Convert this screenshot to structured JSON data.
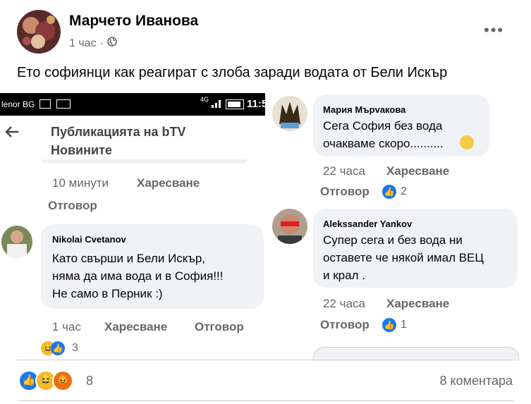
{
  "post": {
    "author": "Марчето Иванова",
    "time": "1 час",
    "text": "Ето софиянци как реагират с злоба заради водата от Бели Искър",
    "reactions_count": "8",
    "comments_count": "8 коментара"
  },
  "left_shot": {
    "statusbar": {
      "carrier": "lenor BG",
      "signal": "4G",
      "time": "11:5"
    },
    "header_title": "Публикацията на bTV Новините",
    "prev_time": "10 минути",
    "prev_like": "Харесване",
    "prev_reply": "Отговор",
    "comment": {
      "name": "Nikolai Cvetanov",
      "text_lines": [
        "Като свърши и Бели Искър,",
        "няма да има вода и в София!!!",
        "Не само в Перник :)"
      ],
      "time": "1 час",
      "like": "Харесване",
      "reply": "Отговор",
      "reactions": "3"
    }
  },
  "right_shot": {
    "comment1": {
      "name": "Мария Мърvакова",
      "text_lines": [
        "Сега София без вода",
        "очакваме скоро.........."
      ],
      "time": "22 часа",
      "like": "Харесване",
      "reply": "Отговор",
      "reactions": "2"
    },
    "comment2": {
      "name": "Alekssander Yankov",
      "text_lines": [
        "Супер сега и без вода ни",
        "оставете  че някой имал ВЕЦ",
        "и крал ."
      ],
      "time": "22 часа",
      "like": "Харесване",
      "reply": "Отговор",
      "reactions": "1"
    }
  },
  "colors": {
    "like": "#1877f2",
    "haha": "#f7b928",
    "angry": "#e9710f",
    "secondary_text": "#65676b",
    "bubble": "#f0f2f5"
  },
  "icons": [
    "globe-icon",
    "more-icon",
    "back-arrow-icon",
    "like-icon",
    "haha-icon",
    "angry-icon",
    "weary-emoji-icon"
  ]
}
